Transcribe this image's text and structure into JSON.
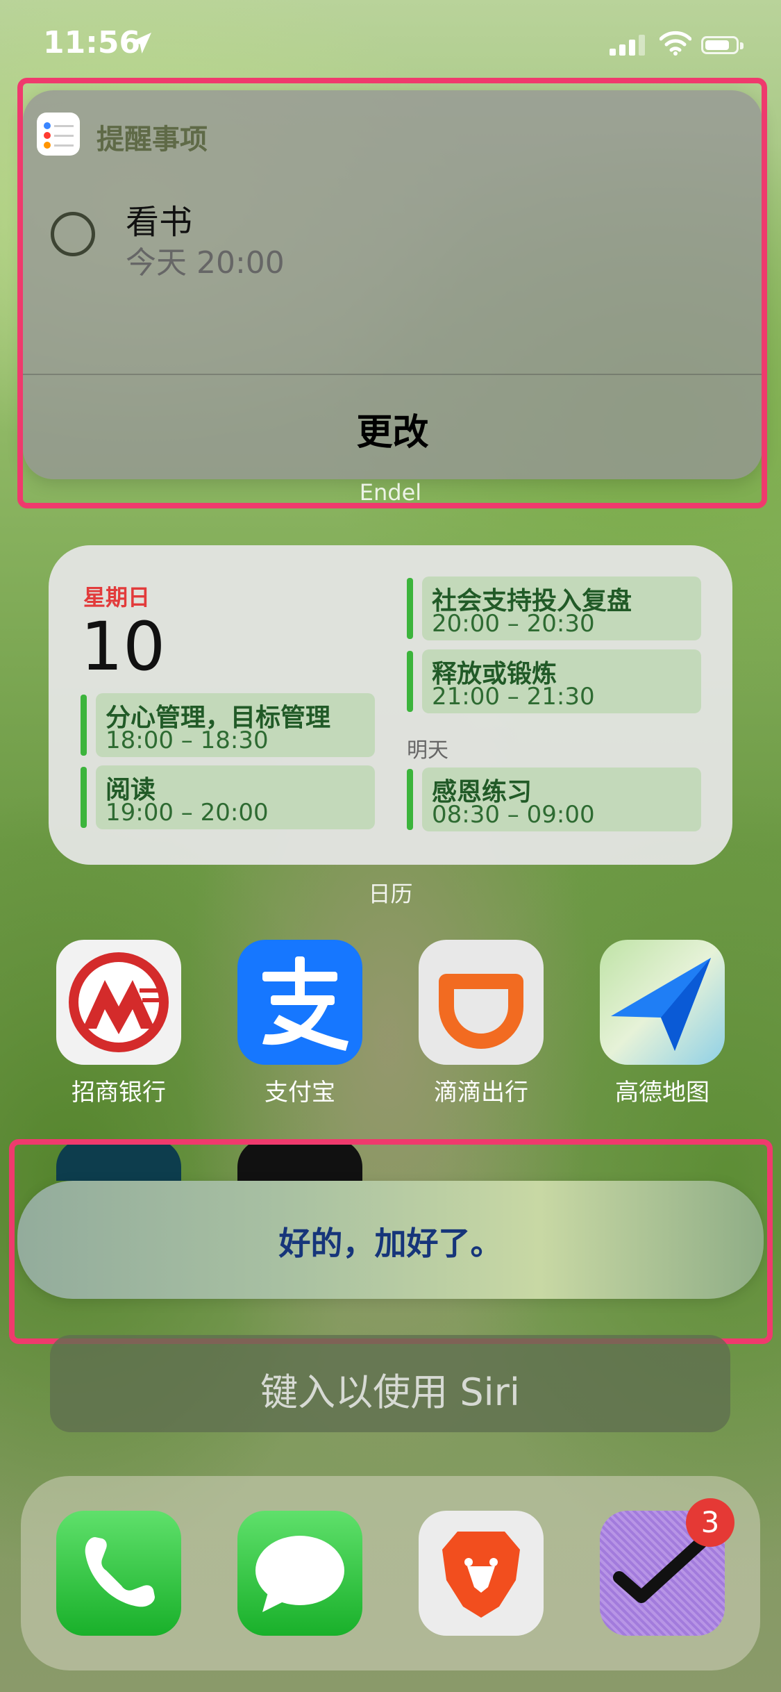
{
  "status_bar": {
    "time": "11:56"
  },
  "reminder_widget": {
    "app_name": "提醒事项",
    "item_title": "看书",
    "item_due": "今天 20:00",
    "action_label": "更改",
    "below_label": "Endel"
  },
  "calendar_widget": {
    "weekday": "星期日",
    "day": "10",
    "events_left": [
      {
        "name": "分心管理，目标管理",
        "time": "18:00 – 18:30"
      },
      {
        "name": "阅读",
        "time": "19:00 – 20:00"
      }
    ],
    "events_right": [
      {
        "name": "社会支持投入复盘",
        "time": "20:00 – 20:30"
      },
      {
        "name": "释放或锻炼",
        "time": "21:00 – 21:30"
      }
    ],
    "tomorrow_label": "明天",
    "tomorrow_events": [
      {
        "name": "感恩练习",
        "time": "08:30 – 09:00"
      }
    ],
    "widget_label": "日历"
  },
  "apps_row": [
    {
      "label": "招商银行",
      "icon": "cmb-icon"
    },
    {
      "label": "支付宝",
      "icon": "alipay-icon"
    },
    {
      "label": "滴滴出行",
      "icon": "didi-icon"
    },
    {
      "label": "高德地图",
      "icon": "amap-icon"
    }
  ],
  "siri": {
    "response": "好的，加好了。",
    "input_placeholder": "键入以使用 Siri"
  },
  "dock": {
    "apps": [
      "phone-icon",
      "messages-icon",
      "brave-icon",
      "omnifocus-icon"
    ],
    "badge_count": "3"
  },
  "colors": {
    "highlight": "#ef3a6d",
    "calendar_accent": "#3cb43c",
    "weekday_red": "#e23b3b",
    "siri_text": "#16357a"
  }
}
